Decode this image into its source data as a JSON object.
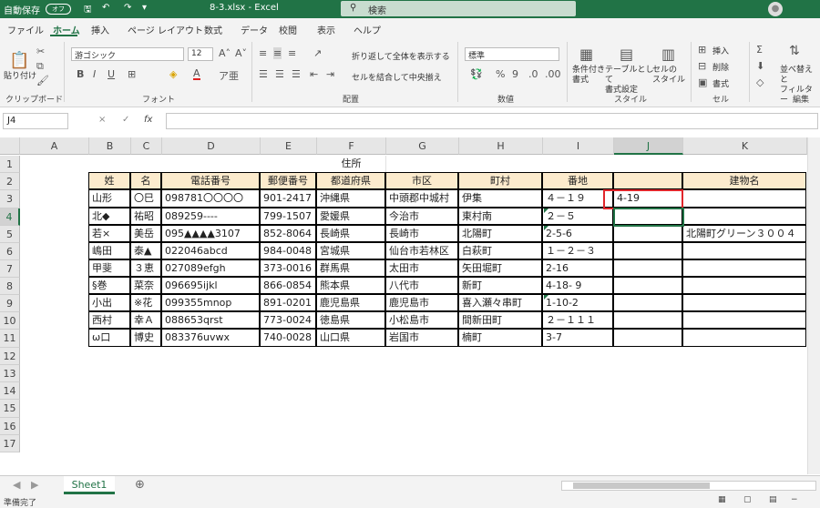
{
  "titlebar": {
    "autosave": "自動保存",
    "toggle": "オフ",
    "filename": "8-3.xlsx - Excel",
    "search_placeholder": "検索",
    "search_icon": "search-icon",
    "user_icon": "user-icon"
  },
  "tabs": [
    "ファイル",
    "ホーム",
    "挿入",
    "ページ レイアウト",
    "数式",
    "データ",
    "校閲",
    "表示",
    "ヘルプ"
  ],
  "ribbon": {
    "paste": "貼り付け",
    "clipboard": "クリップボード",
    "font_name": "游ゴシック",
    "font_size": "12",
    "font_group": "フォント",
    "wrap": "折り返して全体を表示する",
    "merge": "セルを結合して中央揃え",
    "align_group": "配置",
    "number_format": "標準",
    "number_group": "数値",
    "cond_format": "条件付き\n書式",
    "table_format": "テーブルとして\n書式設定",
    "cell_style": "セルの\nスタイル",
    "style_group": "スタイル",
    "insert": "挿入",
    "delete": "削除",
    "format": "書式",
    "cells_group": "セル",
    "sort_filter": "並べ替えと\nフィルター",
    "edit_group": "編集",
    "bold": "B",
    "italic": "I",
    "underline": "U",
    "font_color": "A",
    "percent": "%"
  },
  "formula": {
    "namebox": "J4",
    "cancel": "×",
    "enter": "✓",
    "fx": "fx",
    "value": ""
  },
  "columns": [
    "A",
    "B",
    "C",
    "D",
    "E",
    "F",
    "G",
    "H",
    "I",
    "J",
    "K"
  ],
  "rows": [
    "1",
    "2",
    "3",
    "4",
    "5",
    "6",
    "7",
    "8",
    "9",
    "10",
    "11",
    "12",
    "13",
    "14",
    "15",
    "16",
    "17"
  ],
  "sheet": {
    "title": "住所",
    "headers": [
      "姓",
      "名",
      "電話番号",
      "郵便番号",
      "都道府県",
      "市区",
      "町村",
      "番地",
      "",
      "建物名"
    ],
    "data": [
      [
        "山形",
        "〇巳",
        "098781〇〇〇〇",
        "901-2417",
        "沖縄県",
        "中頭郡中城村",
        "伊集",
        "４－１９",
        "4-19",
        ""
      ],
      [
        "北◆",
        "祐昭",
        "089259----",
        "799-1507",
        "愛媛県",
        "今治市",
        "東村南",
        "２－５",
        "",
        ""
      ],
      [
        "若×",
        "美岳",
        "095▲▲▲▲3107",
        "852-8064",
        "長崎県",
        "長崎市",
        "北陽町",
        "2-5-6",
        "",
        "北陽町グリーン３００４"
      ],
      [
        "嶋田",
        "泰▲",
        "022046abcd",
        "984-0048",
        "宮城県",
        "仙台市若林区",
        "白萩町",
        "１－２－３",
        "",
        ""
      ],
      [
        "甲斐",
        "３恵",
        "027089efgh",
        "373-0016",
        "群馬県",
        "太田市",
        "矢田堀町",
        "2-16",
        "",
        ""
      ],
      [
        "§巻",
        "菜奈",
        "096695ijkl",
        "866-0854",
        "熊本県",
        "八代市",
        "新町",
        "4-18- 9",
        "",
        ""
      ],
      [
        "小出",
        "※花",
        "099355mnop",
        "891-0201",
        "鹿児島県",
        "鹿児島市",
        "喜入瀬々串町",
        "1-10-2",
        "",
        ""
      ],
      [
        "西村",
        "幸Ａ",
        "088653qrst",
        "773-0024",
        "徳島県",
        "小松島市",
        "間新田町",
        "２－１１１",
        "",
        ""
      ],
      [
        "ω口",
        "博史",
        "083376uvwx",
        "740-0028",
        "山口県",
        "岩国市",
        "楠町",
        "3-7",
        "",
        ""
      ]
    ]
  },
  "sheet_tab": "Sheet1",
  "status": "準備完了"
}
